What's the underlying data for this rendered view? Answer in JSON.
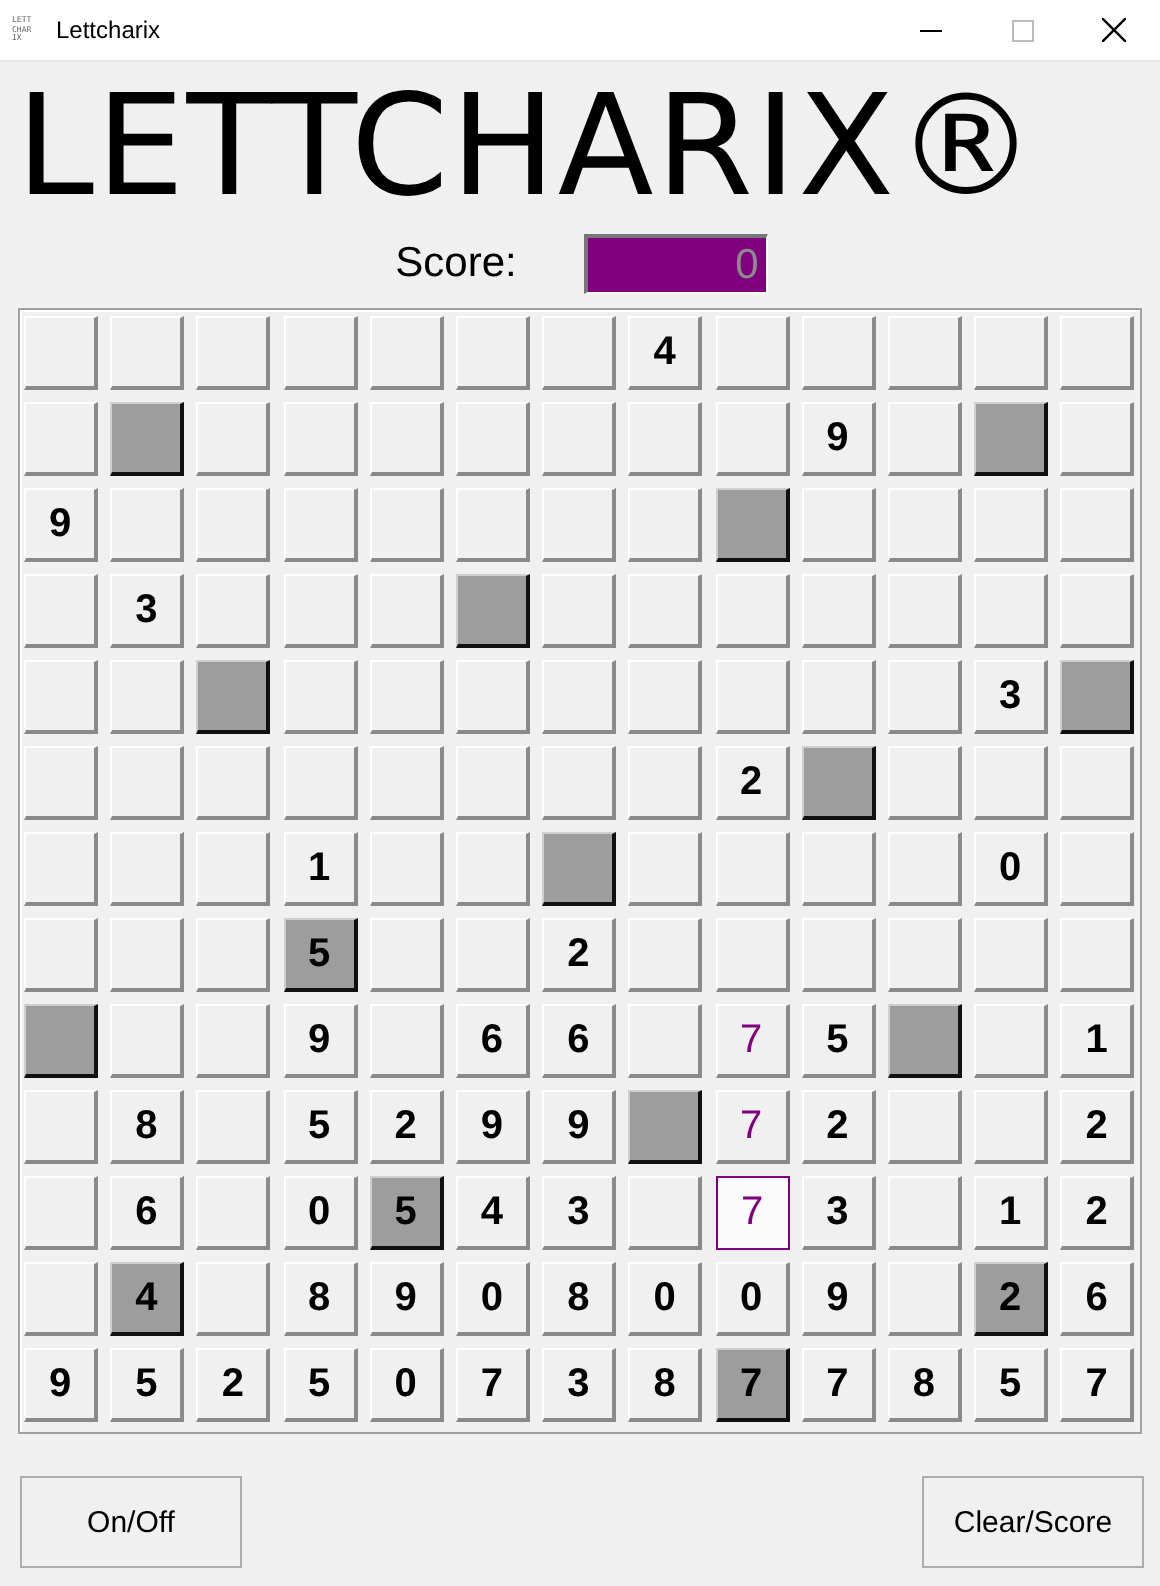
{
  "window": {
    "title": "Lettcharix",
    "icon_text": "LETT CHAR IX"
  },
  "logo": "LETTCHARIX®",
  "score": {
    "label": "Score:",
    "value": "0"
  },
  "grid": [
    [
      {
        "shaded": false,
        "selected": false
      },
      {
        "shaded": false,
        "selected": false
      },
      {
        "shaded": false,
        "selected": false
      },
      {
        "shaded": false,
        "selected": false
      },
      {
        "shaded": false,
        "selected": false
      },
      {
        "shaded": false,
        "selected": false
      },
      {
        "shaded": false,
        "selected": false
      },
      {
        "text": "4",
        "shaded": false,
        "marked": false,
        "selected": false
      },
      {
        "shaded": false,
        "selected": false
      },
      {
        "shaded": false,
        "selected": false
      },
      {
        "shaded": false,
        "selected": false
      },
      {
        "shaded": false,
        "selected": false
      },
      {
        "shaded": false,
        "selected": false
      }
    ],
    [
      {
        "shaded": false,
        "selected": false
      },
      {
        "shaded": true,
        "selected": false
      },
      {
        "shaded": false,
        "selected": false
      },
      {
        "shaded": false,
        "selected": false
      },
      {
        "shaded": false,
        "selected": false
      },
      {
        "shaded": false,
        "selected": false
      },
      {
        "shaded": false,
        "selected": false
      },
      {
        "shaded": false,
        "selected": false
      },
      {
        "shaded": false,
        "selected": false
      },
      {
        "text": "9",
        "shaded": false,
        "marked": false,
        "selected": false
      },
      {
        "shaded": false,
        "selected": false
      },
      {
        "shaded": true,
        "selected": false
      },
      {
        "shaded": false,
        "selected": false
      }
    ],
    [
      {
        "text": "9",
        "shaded": false,
        "marked": false,
        "selected": false
      },
      {
        "shaded": false,
        "selected": false
      },
      {
        "shaded": false,
        "selected": false
      },
      {
        "shaded": false,
        "selected": false
      },
      {
        "shaded": false,
        "selected": false
      },
      {
        "shaded": false,
        "selected": false
      },
      {
        "shaded": false,
        "selected": false
      },
      {
        "shaded": false,
        "selected": false
      },
      {
        "shaded": true,
        "selected": false
      },
      {
        "shaded": false,
        "selected": false
      },
      {
        "shaded": false,
        "selected": false
      },
      {
        "shaded": false,
        "selected": false
      },
      {
        "shaded": false,
        "selected": false
      }
    ],
    [
      {
        "shaded": false,
        "selected": false
      },
      {
        "text": "3",
        "shaded": false,
        "marked": false,
        "selected": false
      },
      {
        "shaded": false,
        "selected": false
      },
      {
        "shaded": false,
        "selected": false
      },
      {
        "shaded": false,
        "selected": false
      },
      {
        "shaded": true,
        "selected": false
      },
      {
        "shaded": false,
        "selected": false
      },
      {
        "shaded": false,
        "selected": false
      },
      {
        "shaded": false,
        "selected": false
      },
      {
        "shaded": false,
        "selected": false
      },
      {
        "shaded": false,
        "selected": false
      },
      {
        "shaded": false,
        "selected": false
      },
      {
        "shaded": false,
        "selected": false
      }
    ],
    [
      {
        "shaded": false,
        "selected": false
      },
      {
        "shaded": false,
        "selected": false
      },
      {
        "shaded": true,
        "selected": false
      },
      {
        "shaded": false,
        "selected": false
      },
      {
        "shaded": false,
        "selected": false
      },
      {
        "shaded": false,
        "selected": false
      },
      {
        "shaded": false,
        "selected": false
      },
      {
        "shaded": false,
        "selected": false
      },
      {
        "shaded": false,
        "selected": false
      },
      {
        "shaded": false,
        "selected": false
      },
      {
        "shaded": false,
        "selected": false
      },
      {
        "text": "3",
        "shaded": false,
        "marked": false,
        "selected": false
      },
      {
        "shaded": true,
        "selected": false
      }
    ],
    [
      {
        "shaded": false,
        "selected": false
      },
      {
        "shaded": false,
        "selected": false
      },
      {
        "shaded": false,
        "selected": false
      },
      {
        "shaded": false,
        "selected": false
      },
      {
        "shaded": false,
        "selected": false
      },
      {
        "shaded": false,
        "selected": false
      },
      {
        "shaded": false,
        "selected": false
      },
      {
        "shaded": false,
        "selected": false
      },
      {
        "text": "2",
        "shaded": false,
        "marked": false,
        "selected": false
      },
      {
        "shaded": true,
        "selected": false
      },
      {
        "shaded": false,
        "selected": false
      },
      {
        "shaded": false,
        "selected": false
      },
      {
        "shaded": false,
        "selected": false
      }
    ],
    [
      {
        "shaded": false,
        "selected": false
      },
      {
        "shaded": false,
        "selected": false
      },
      {
        "shaded": false,
        "selected": false
      },
      {
        "text": "1",
        "shaded": false,
        "marked": false,
        "selected": false
      },
      {
        "shaded": false,
        "selected": false
      },
      {
        "shaded": false,
        "selected": false
      },
      {
        "shaded": true,
        "selected": false
      },
      {
        "shaded": false,
        "selected": false
      },
      {
        "shaded": false,
        "selected": false
      },
      {
        "shaded": false,
        "selected": false
      },
      {
        "shaded": false,
        "selected": false
      },
      {
        "text": "0",
        "shaded": false,
        "marked": false,
        "selected": false
      },
      {
        "shaded": false,
        "selected": false
      }
    ],
    [
      {
        "shaded": false,
        "selected": false
      },
      {
        "shaded": false,
        "selected": false
      },
      {
        "shaded": false,
        "selected": false
      },
      {
        "text": "5",
        "shaded": true,
        "marked": false,
        "selected": false
      },
      {
        "shaded": false,
        "selected": false
      },
      {
        "shaded": false,
        "selected": false
      },
      {
        "text": "2",
        "shaded": false,
        "marked": false,
        "selected": false
      },
      {
        "shaded": false,
        "selected": false
      },
      {
        "shaded": false,
        "selected": false
      },
      {
        "shaded": false,
        "selected": false
      },
      {
        "shaded": false,
        "selected": false
      },
      {
        "shaded": false,
        "selected": false
      },
      {
        "shaded": false,
        "selected": false
      }
    ],
    [
      {
        "shaded": true,
        "selected": false
      },
      {
        "shaded": false,
        "selected": false
      },
      {
        "shaded": false,
        "selected": false
      },
      {
        "text": "9",
        "shaded": false,
        "marked": false,
        "selected": false
      },
      {
        "shaded": false,
        "selected": false
      },
      {
        "text": "6",
        "shaded": false,
        "marked": false,
        "selected": false
      },
      {
        "text": "6",
        "shaded": false,
        "marked": false,
        "selected": false
      },
      {
        "shaded": false,
        "selected": false
      },
      {
        "text": "7",
        "shaded": false,
        "marked": true,
        "selected": false
      },
      {
        "text": "5",
        "shaded": false,
        "marked": false,
        "selected": false
      },
      {
        "shaded": true,
        "selected": false
      },
      {
        "shaded": false,
        "selected": false
      },
      {
        "text": "1",
        "shaded": false,
        "marked": false,
        "selected": false
      }
    ],
    [
      {
        "shaded": false,
        "selected": false
      },
      {
        "text": "8",
        "shaded": false,
        "marked": false,
        "selected": false
      },
      {
        "shaded": false,
        "selected": false
      },
      {
        "text": "5",
        "shaded": false,
        "marked": false,
        "selected": false
      },
      {
        "text": "2",
        "shaded": false,
        "marked": false,
        "selected": false
      },
      {
        "text": "9",
        "shaded": false,
        "marked": false,
        "selected": false
      },
      {
        "text": "9",
        "shaded": false,
        "marked": false,
        "selected": false
      },
      {
        "shaded": true,
        "selected": false
      },
      {
        "text": "7",
        "shaded": false,
        "marked": true,
        "selected": false
      },
      {
        "text": "2",
        "shaded": false,
        "marked": false,
        "selected": false
      },
      {
        "shaded": false,
        "selected": false
      },
      {
        "shaded": false,
        "selected": false
      },
      {
        "text": "2",
        "shaded": false,
        "marked": false,
        "selected": false
      }
    ],
    [
      {
        "shaded": false,
        "selected": false
      },
      {
        "text": "6",
        "shaded": false,
        "marked": false,
        "selected": false
      },
      {
        "shaded": false,
        "selected": false
      },
      {
        "text": "0",
        "shaded": false,
        "marked": false,
        "selected": false
      },
      {
        "text": "5",
        "shaded": true,
        "marked": false,
        "selected": false
      },
      {
        "text": "4",
        "shaded": false,
        "marked": false,
        "selected": false
      },
      {
        "text": "3",
        "shaded": false,
        "marked": false,
        "selected": false
      },
      {
        "shaded": false,
        "selected": false
      },
      {
        "text": "7",
        "shaded": false,
        "marked": true,
        "selected": true
      },
      {
        "text": "3",
        "shaded": false,
        "marked": false,
        "selected": false
      },
      {
        "shaded": false,
        "selected": false
      },
      {
        "text": "1",
        "shaded": false,
        "marked": false,
        "selected": false
      },
      {
        "text": "2",
        "shaded": false,
        "marked": false,
        "selected": false
      }
    ],
    [
      {
        "shaded": false,
        "selected": false
      },
      {
        "text": "4",
        "shaded": true,
        "marked": false,
        "selected": false
      },
      {
        "shaded": false,
        "selected": false
      },
      {
        "text": "8",
        "shaded": false,
        "marked": false,
        "selected": false
      },
      {
        "text": "9",
        "shaded": false,
        "marked": false,
        "selected": false
      },
      {
        "text": "0",
        "shaded": false,
        "marked": false,
        "selected": false
      },
      {
        "text": "8",
        "shaded": false,
        "marked": false,
        "selected": false
      },
      {
        "text": "0",
        "shaded": false,
        "marked": false,
        "selected": false
      },
      {
        "text": "0",
        "shaded": false,
        "marked": false,
        "selected": false
      },
      {
        "text": "9",
        "shaded": false,
        "marked": false,
        "selected": false
      },
      {
        "shaded": false,
        "selected": false
      },
      {
        "text": "2",
        "shaded": true,
        "marked": false,
        "selected": false
      },
      {
        "text": "6",
        "shaded": false,
        "marked": false,
        "selected": false
      }
    ],
    [
      {
        "text": "9",
        "shaded": false,
        "marked": false,
        "selected": false
      },
      {
        "text": "5",
        "shaded": false,
        "marked": false,
        "selected": false
      },
      {
        "text": "2",
        "shaded": false,
        "marked": false,
        "selected": false
      },
      {
        "text": "5",
        "shaded": false,
        "marked": false,
        "selected": false
      },
      {
        "text": "0",
        "shaded": false,
        "marked": false,
        "selected": false
      },
      {
        "text": "7",
        "shaded": false,
        "marked": false,
        "selected": false
      },
      {
        "text": "3",
        "shaded": false,
        "marked": false,
        "selected": false
      },
      {
        "text": "8",
        "shaded": false,
        "marked": false,
        "selected": false
      },
      {
        "text": "7",
        "shaded": true,
        "marked": false,
        "selected": false
      },
      {
        "text": "7",
        "shaded": false,
        "marked": false,
        "selected": false
      },
      {
        "text": "8",
        "shaded": false,
        "marked": false,
        "selected": false
      },
      {
        "text": "5",
        "shaded": false,
        "marked": false,
        "selected": false
      },
      {
        "text": "7",
        "shaded": false,
        "marked": false,
        "selected": false
      }
    ]
  ],
  "buttons": [
    "On/Off",
    "Clear/Score"
  ]
}
